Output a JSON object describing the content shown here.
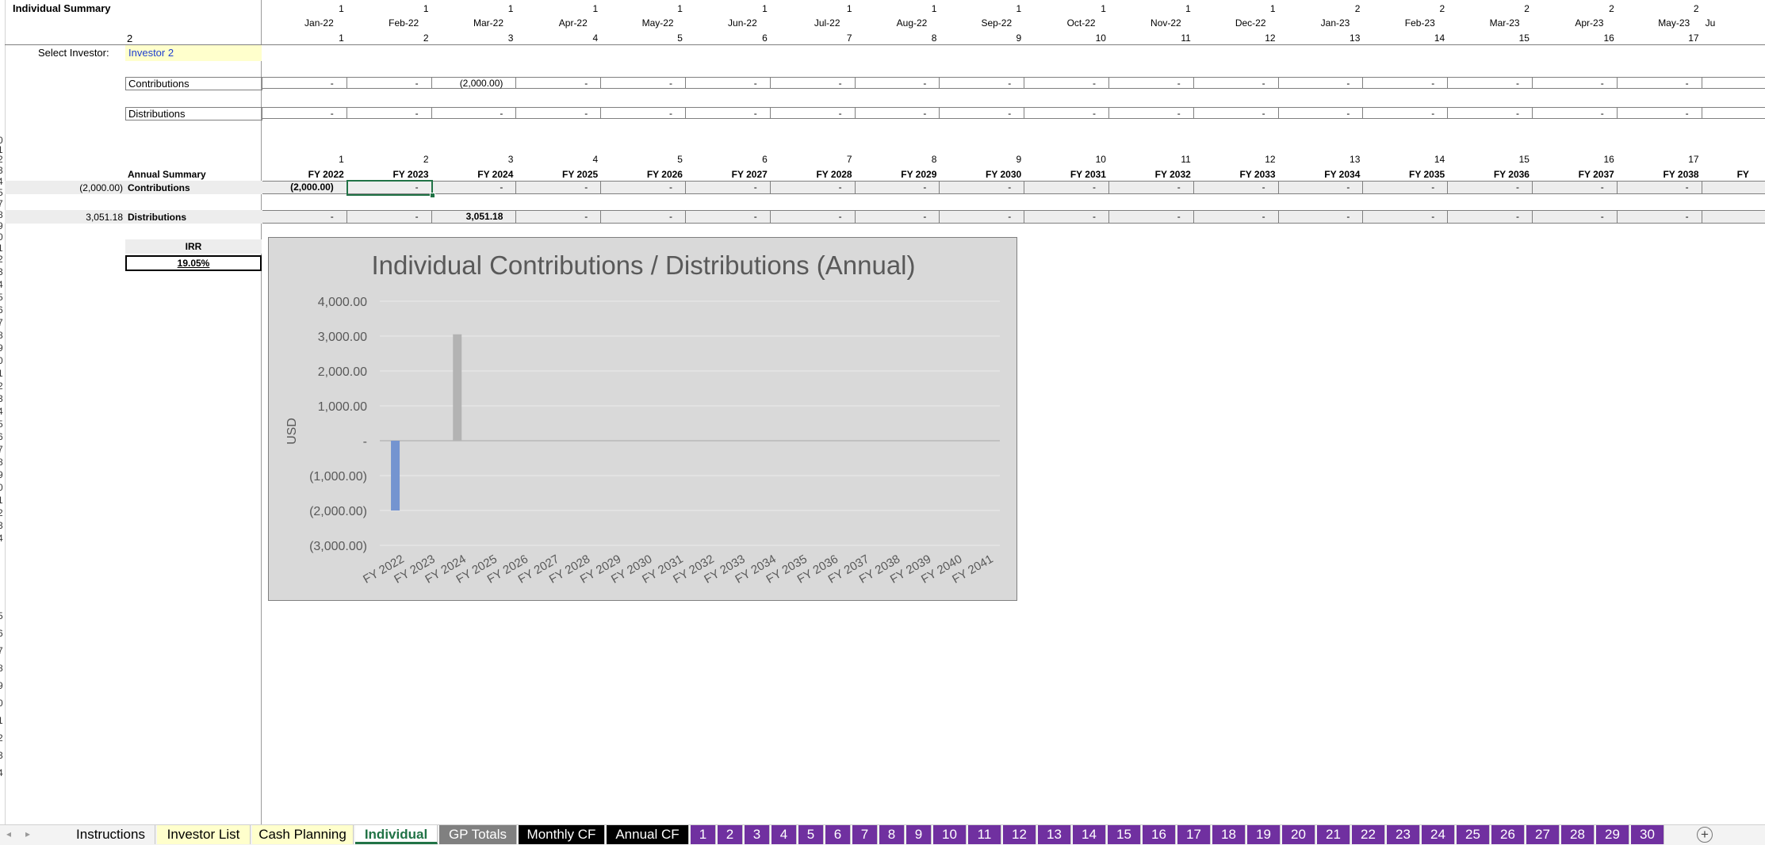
{
  "sheet": {
    "title": "Individual Summary",
    "investor_index": "2",
    "select_label": "Select Investor:",
    "selected_investor": "Investor 2",
    "row_numbers": [
      "0",
      "1",
      "2",
      "3",
      "4",
      "5",
      "7",
      "8",
      "9",
      "0",
      "1",
      "2",
      "3",
      "4",
      "5",
      "6",
      "7",
      "8",
      "9",
      "0",
      "1",
      "2",
      "3",
      "4",
      "5",
      "6",
      "7",
      "8",
      "9",
      "0",
      "1",
      "2",
      "3",
      "4"
    ],
    "monthly_header": {
      "year_flags": [
        "1",
        "1",
        "1",
        "1",
        "1",
        "1",
        "1",
        "1",
        "1",
        "1",
        "1",
        "1",
        "2",
        "2",
        "2",
        "2",
        "2"
      ],
      "months": [
        "Jan-22",
        "Feb-22",
        "Mar-22",
        "Apr-22",
        "May-22",
        "Jun-22",
        "Jul-22",
        "Aug-22",
        "Sep-22",
        "Oct-22",
        "Nov-22",
        "Dec-22",
        "Jan-23",
        "Feb-23",
        "Mar-23",
        "Apr-23",
        "May-23"
      ],
      "next_month_partial": "Ju",
      "period_numbers": [
        "1",
        "2",
        "3",
        "4",
        "5",
        "6",
        "7",
        "8",
        "9",
        "10",
        "11",
        "12",
        "13",
        "14",
        "15",
        "16",
        "17"
      ]
    },
    "monthly_rows": {
      "contributions_label": "Contributions",
      "contributions": [
        "-",
        "-",
        "(2,000.00)",
        "-",
        "-",
        "-",
        "-",
        "-",
        "-",
        "-",
        "-",
        "-",
        "-",
        "-",
        "-",
        "-",
        "-"
      ],
      "distributions_label": "Distributions",
      "distributions": [
        "-",
        "-",
        "-",
        "-",
        "-",
        "-",
        "-",
        "-",
        "-",
        "-",
        "-",
        "-",
        "-",
        "-",
        "-",
        "-",
        "-"
      ]
    },
    "annual_header": {
      "label": "Annual Summary",
      "numbers": [
        "1",
        "2",
        "3",
        "4",
        "5",
        "6",
        "7",
        "8",
        "9",
        "10",
        "11",
        "12",
        "13",
        "14",
        "15",
        "16",
        "17"
      ],
      "years": [
        "FY 2022",
        "FY 2023",
        "FY 2024",
        "FY 2025",
        "FY 2026",
        "FY 2027",
        "FY 2028",
        "FY 2029",
        "FY 2030",
        "FY 2031",
        "FY 2032",
        "FY 2033",
        "FY 2034",
        "FY 2035",
        "FY 2036",
        "FY 2037",
        "FY 2038"
      ],
      "next_year_partial": "FY"
    },
    "annual_rows": {
      "contributions_total": "(2,000.00)",
      "contributions_label": "Contributions",
      "contributions": [
        "(2,000.00)",
        "-",
        "-",
        "-",
        "-",
        "-",
        "-",
        "-",
        "-",
        "-",
        "-",
        "-",
        "-",
        "-",
        "-",
        "-",
        "-"
      ],
      "distributions_total": "3,051.18",
      "distributions_label": "Distributions",
      "distributions": [
        "-",
        "-",
        "3,051.18",
        "-",
        "-",
        "-",
        "-",
        "-",
        "-",
        "-",
        "-",
        "-",
        "-",
        "-",
        "-",
        "-",
        "-"
      ]
    },
    "irr_label": "IRR",
    "irr_value": "19.05%"
  },
  "chart_data": {
    "type": "bar",
    "title": "Individual Contributions / Distributions (Annual)",
    "ylabel": "USD",
    "xlabel": "",
    "categories": [
      "FY 2022",
      "FY 2023",
      "FY 2024",
      "FY 2025",
      "FY 2026",
      "FY 2027",
      "FY 2028",
      "FY 2029",
      "FY 2030",
      "FY 2031",
      "FY 2032",
      "FY 2033",
      "FY 2034",
      "FY 2035",
      "FY 2036",
      "FY 2037",
      "FY 2038",
      "FY 2039",
      "FY 2040",
      "FY 2041"
    ],
    "ylim": [
      -3000,
      4000
    ],
    "yticks": [
      4000,
      3000,
      2000,
      1000,
      0,
      -1000,
      -2000,
      -3000
    ],
    "ytick_labels": [
      "4,000.00",
      "3,000.00",
      "2,000.00",
      "1,000.00",
      "-",
      "(1,000.00)",
      "(2,000.00)",
      "(3,000.00)"
    ],
    "grid": true,
    "series": [
      {
        "name": "Contributions",
        "color": "#7494d0",
        "values": [
          -2000,
          0,
          0,
          0,
          0,
          0,
          0,
          0,
          0,
          0,
          0,
          0,
          0,
          0,
          0,
          0,
          0,
          0,
          0,
          0
        ]
      },
      {
        "name": "Distributions",
        "color": "#b3b3b3",
        "values": [
          0,
          0,
          3051.18,
          0,
          0,
          0,
          0,
          0,
          0,
          0,
          0,
          0,
          0,
          0,
          0,
          0,
          0,
          0,
          0,
          0
        ]
      }
    ]
  },
  "tabs": [
    {
      "label": "Instructions",
      "color": "#f3f3f3",
      "text": "#000000"
    },
    {
      "label": "Investor List",
      "color": "#ffffcc",
      "text": "#000000"
    },
    {
      "label": "Cash Planning",
      "color": "#ffffcc",
      "text": "#000000"
    },
    {
      "label": "Individual",
      "color": "#ffffff",
      "text": "#217346",
      "active": true
    },
    {
      "label": "GP Totals",
      "color": "#808080",
      "text": "#ffffff"
    },
    {
      "label": "Monthly CF",
      "color": "#000000",
      "text": "#ffffff"
    },
    {
      "label": "Annual CF",
      "color": "#000000",
      "text": "#ffffff"
    },
    {
      "label": "1",
      "color": "#7030a0",
      "text": "#ffffff"
    },
    {
      "label": "2",
      "color": "#7030a0",
      "text": "#ffffff"
    },
    {
      "label": "3",
      "color": "#7030a0",
      "text": "#ffffff"
    },
    {
      "label": "4",
      "color": "#7030a0",
      "text": "#ffffff"
    },
    {
      "label": "5",
      "color": "#7030a0",
      "text": "#ffffff"
    },
    {
      "label": "6",
      "color": "#7030a0",
      "text": "#ffffff"
    },
    {
      "label": "7",
      "color": "#7030a0",
      "text": "#ffffff"
    },
    {
      "label": "8",
      "color": "#7030a0",
      "text": "#ffffff"
    },
    {
      "label": "9",
      "color": "#7030a0",
      "text": "#ffffff"
    },
    {
      "label": "10",
      "color": "#7030a0",
      "text": "#ffffff"
    },
    {
      "label": "11",
      "color": "#7030a0",
      "text": "#ffffff"
    },
    {
      "label": "12",
      "color": "#7030a0",
      "text": "#ffffff"
    },
    {
      "label": "13",
      "color": "#7030a0",
      "text": "#ffffff"
    },
    {
      "label": "14",
      "color": "#7030a0",
      "text": "#ffffff"
    },
    {
      "label": "15",
      "color": "#7030a0",
      "text": "#ffffff"
    },
    {
      "label": "16",
      "color": "#7030a0",
      "text": "#ffffff"
    },
    {
      "label": "17",
      "color": "#7030a0",
      "text": "#ffffff"
    },
    {
      "label": "18",
      "color": "#7030a0",
      "text": "#ffffff"
    },
    {
      "label": "19",
      "color": "#7030a0",
      "text": "#ffffff"
    },
    {
      "label": "20",
      "color": "#7030a0",
      "text": "#ffffff"
    },
    {
      "label": "21",
      "color": "#7030a0",
      "text": "#ffffff"
    },
    {
      "label": "22",
      "color": "#7030a0",
      "text": "#ffffff"
    },
    {
      "label": "23",
      "color": "#7030a0",
      "text": "#ffffff"
    },
    {
      "label": "24",
      "color": "#7030a0",
      "text": "#ffffff"
    },
    {
      "label": "25",
      "color": "#7030a0",
      "text": "#ffffff"
    },
    {
      "label": "26",
      "color": "#7030a0",
      "text": "#ffffff"
    },
    {
      "label": "27",
      "color": "#7030a0",
      "text": "#ffffff"
    },
    {
      "label": "28",
      "color": "#7030a0",
      "text": "#ffffff"
    },
    {
      "label": "29",
      "color": "#7030a0",
      "text": "#ffffff"
    },
    {
      "label": "30",
      "color": "#7030a0",
      "text": "#ffffff"
    }
  ],
  "icons": {
    "add_sheet": "plus-circle-icon",
    "nav_prev": "triangle-left-icon",
    "nav_next": "triangle-right-icon"
  },
  "glyphs": {
    "add_sheet": "+",
    "nav_prev": "◂",
    "nav_next": "▸"
  }
}
